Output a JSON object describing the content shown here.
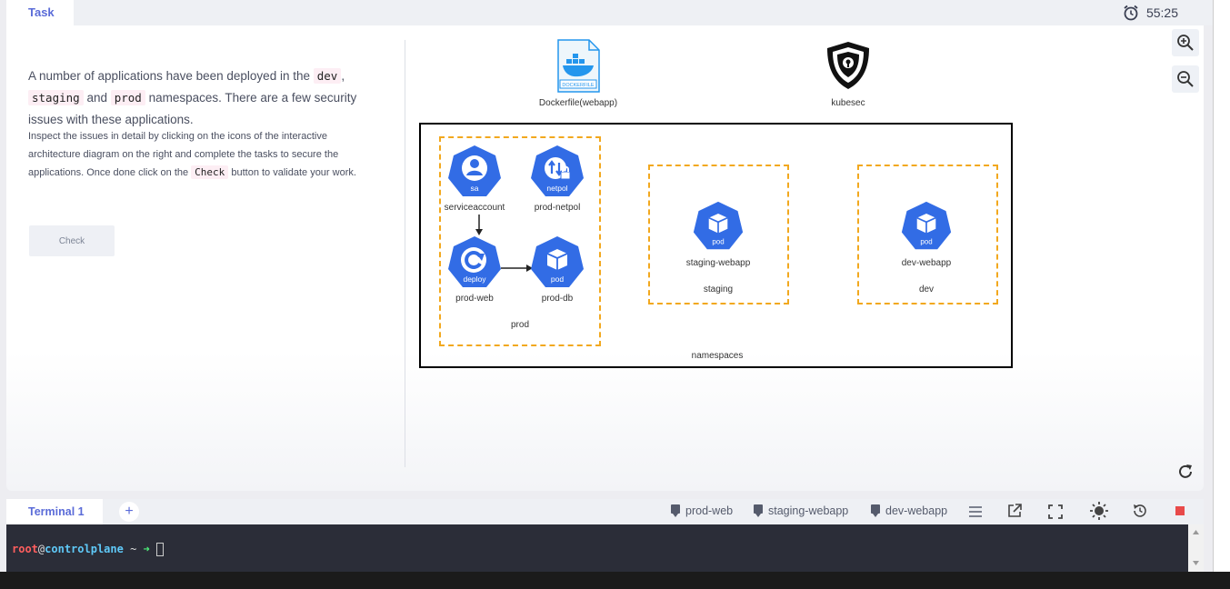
{
  "header": {
    "task_tab": "Task",
    "timer": "55:25"
  },
  "left": {
    "intro_1": "A number of applications have been deployed in the ",
    "ns_dev": "dev",
    "comma": ",",
    "ns_staging": "staging",
    "and_word": " and ",
    "ns_prod": "prod",
    "intro_2": " namespaces. There are a few security issues with these applications.",
    "details_1": "Inspect the issues in detail by clicking on the icons of the interactive architecture diagram on the right and complete the tasks to secure the applications. Once done click on the ",
    "check_code": "Check",
    "details_2": " button to validate your work.",
    "check_button": "Check"
  },
  "diagram": {
    "dockerfile_label": "Dockerfile(webapp)",
    "dockerfile_badge": "DOCKERFILE",
    "kubesec_label": "kubesec",
    "namespaces_label": "namespaces",
    "prod": {
      "label": "prod",
      "serviceaccount": {
        "badge": "sa",
        "label": "serviceaccount"
      },
      "netpol": {
        "badge": "netpol",
        "label": "prod-netpol"
      },
      "deploy": {
        "badge": "deploy",
        "label": "prod-web"
      },
      "pod": {
        "badge": "pod",
        "label": "prod-db"
      }
    },
    "staging": {
      "label": "staging",
      "pod_badge": "pod",
      "pod_label": "staging-webapp"
    },
    "dev": {
      "label": "dev",
      "pod_badge": "pod",
      "pod_label": "dev-webapp"
    }
  },
  "terminal": {
    "tab": "Terminal 1",
    "add": "+",
    "toolbar": [
      "prod-web",
      "staging-webapp",
      "dev-webapp"
    ],
    "prompt_user": "root",
    "prompt_at": "@",
    "prompt_host": "controlplane",
    "prompt_tilde": " ~ ",
    "prompt_arrow": "➜ "
  },
  "colors": {
    "accent": "#5a6bd8",
    "k8s_blue": "#326ce5",
    "dash_orange": "#f2a81e",
    "terminal_bg": "#2b2d38"
  }
}
